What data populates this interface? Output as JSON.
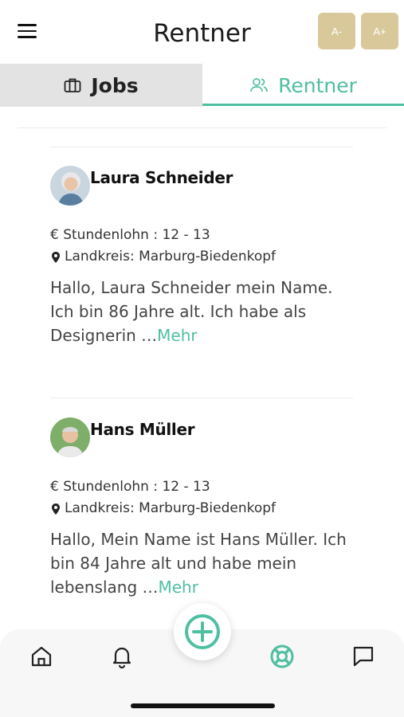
{
  "header": {
    "title": "Rentner",
    "font_decrease_label": "A-",
    "font_increase_label": "A+",
    "menu_icon": "hamburger-icon"
  },
  "tabs": [
    {
      "label": "Jobs",
      "icon": "briefcase-icon",
      "active": false
    },
    {
      "label": "Rentner",
      "icon": "users-icon",
      "active": true
    }
  ],
  "profiles": [
    {
      "name": "Laura Schneider",
      "wage_label": "€ Stundenlohn  : 12 - 13",
      "location_label": "Landkreis: Marburg-Biedenkopf",
      "description": "Hallo, Laura Schneider mein Name. Ich bin 86 Jahre alt. Ich habe als Designerin …",
      "more_label": "Mehr"
    },
    {
      "name": "Hans Müller",
      "wage_label": "€ Stundenlohn  : 12 - 13",
      "location_label": "Landkreis: Marburg-Biedenkopf",
      "description": "Hallo, Mein Name ist Hans Müller. Ich bin 84 Jahre alt und habe mein lebenslang …",
      "more_label": "Mehr"
    }
  ],
  "bottom_nav": [
    {
      "icon": "home-icon"
    },
    {
      "icon": "bell-icon"
    },
    {
      "icon": "add-circle-icon"
    },
    {
      "icon": "lifebuoy-icon",
      "active": true
    },
    {
      "icon": "chat-icon"
    }
  ],
  "colors": {
    "accent": "#4fbfa1",
    "font_button": "#d9c99a",
    "tab_bar": "#e3e3e3"
  }
}
